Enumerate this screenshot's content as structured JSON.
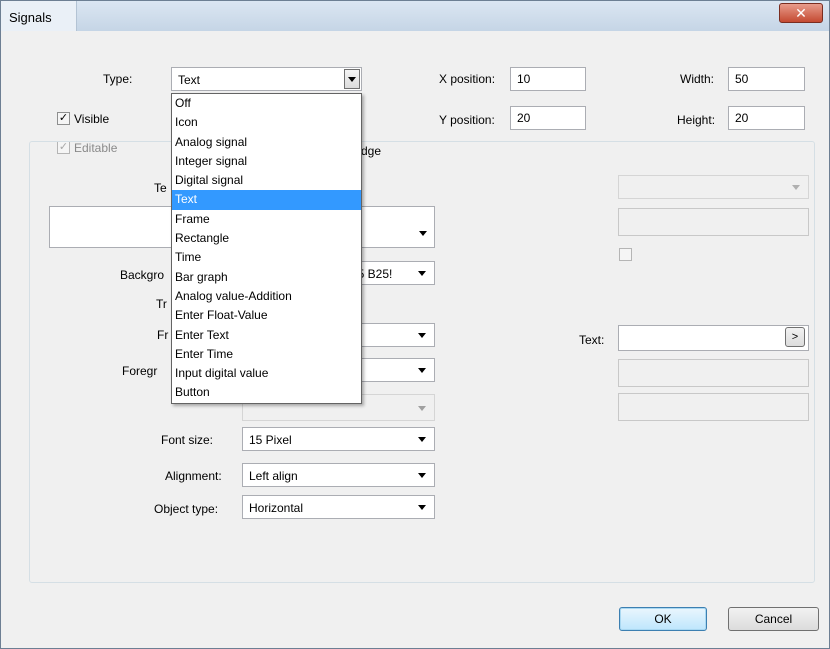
{
  "window": {
    "title": "Signals",
    "close_glyph": "✕"
  },
  "type_row": {
    "label": "Type:",
    "value": "Text"
  },
  "position": {
    "x_label": "X position:",
    "x_value": "10",
    "y_label": "Y position:",
    "y_value": "20"
  },
  "size": {
    "width_label": "Width:",
    "width_value": "50",
    "height_label": "Height:",
    "height_value": "20"
  },
  "checks": {
    "visible_label": "Visible",
    "visible_checked": true,
    "editable_label": "Editable",
    "editable_checked": true,
    "edge_partial_label": "dge"
  },
  "type_options": [
    "Off",
    "Icon",
    "Analog signal",
    "Integer signal",
    "Digital signal",
    "Text",
    "Frame",
    "Rectangle",
    "Time",
    "Bar graph",
    "Analog value-Addition",
    "Enter Float-Value",
    "Enter Text",
    "Enter Time",
    "Input digital value",
    "Button"
  ],
  "type_selected_index": 5,
  "group": {
    "te_partial": "Te",
    "background_partial": "Backgro",
    "background_value_partial": "55 B25!",
    "tr_partial": "Tr",
    "fr_partial": "Fr",
    "foreground_partial": "Foregr",
    "font_size_label": "Font size:",
    "font_size_value": "15 Pixel",
    "alignment_label": "Alignment:",
    "alignment_value": "Left align",
    "object_type_label": "Object type:",
    "object_type_value": "Horizontal",
    "text_label": "Text:",
    "text_button": ">"
  },
  "buttons": {
    "ok": "OK",
    "cancel": "Cancel"
  }
}
